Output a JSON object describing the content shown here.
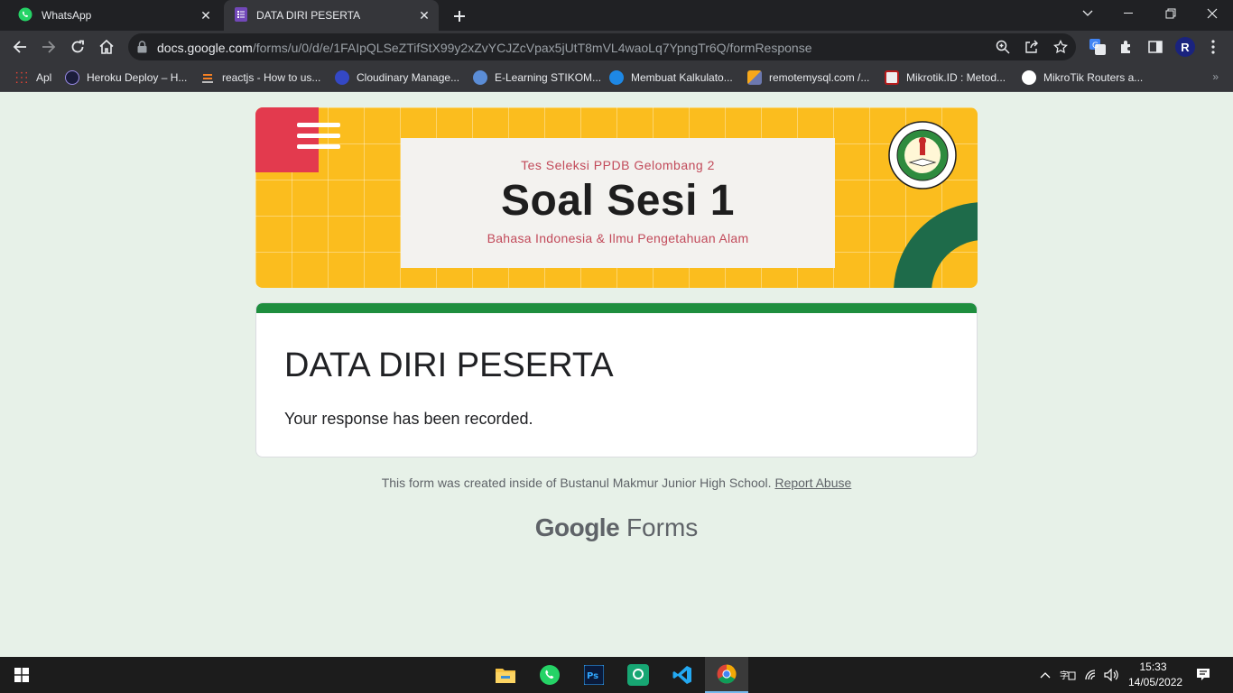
{
  "browser": {
    "tabs": [
      {
        "title": "WhatsApp"
      },
      {
        "title": "DATA DIRI PESERTA"
      }
    ],
    "url_host": "docs.google.com",
    "url_path": "/forms/u/0/d/e/1FAIpQLSeZTifStX99y2xZvYCJZcVpax5jUtT8mVL4waoLq7YpngTr6Q/formResponse",
    "profile_initial": "R",
    "bookmarks": [
      {
        "label": "Apl",
        "icon": "apps-grid-icon"
      },
      {
        "label": "Heroku Deploy – H...",
        "icon": "heroku-icon"
      },
      {
        "label": "reactjs - How to us...",
        "icon": "stackoverflow-icon"
      },
      {
        "label": "Cloudinary Manage...",
        "icon": "cloudinary-icon"
      },
      {
        "label": "E-Learning STIKOM...",
        "icon": "elearning-icon"
      },
      {
        "label": "Membuat Kalkulato...",
        "icon": "blog-icon"
      },
      {
        "label": "remotemysql.com /...",
        "icon": "phpmyadmin-icon"
      },
      {
        "label": "Mikrotik.ID : Metod...",
        "icon": "mikrotik-id-icon"
      },
      {
        "label": "MikroTik Routers a...",
        "icon": "mikrotik-icon"
      }
    ],
    "bookmarks_more": "»"
  },
  "header_banner": {
    "subtitle": "Tes Seleksi PPDB Gelombang 2",
    "title": "Soal Sesi 1",
    "subjects": "Bahasa Indonesia & Ilmu Pengetahuan Alam"
  },
  "form": {
    "title": "DATA DIRI PESERTA",
    "confirmation": "Your response has been recorded."
  },
  "footer": {
    "note": "This form was created inside of Bustanul Makmur Junior High School.",
    "report_link": "Report Abuse",
    "brand_google": "Google",
    "brand_forms": "Forms"
  },
  "taskbar": {
    "apps": [
      "file-explorer-icon",
      "whatsapp-icon",
      "photoshop-icon",
      "gitkraken-icon",
      "vscode-icon",
      "chrome-icon"
    ],
    "time": "15:33",
    "date": "14/05/2022"
  },
  "colors": {
    "page_bg": "#e7f1e8",
    "form_accent": "#1e8e3e",
    "banner_yellow": "#fbbd1e",
    "banner_red": "#e33a4e",
    "banner_green": "#1e6b4a"
  }
}
